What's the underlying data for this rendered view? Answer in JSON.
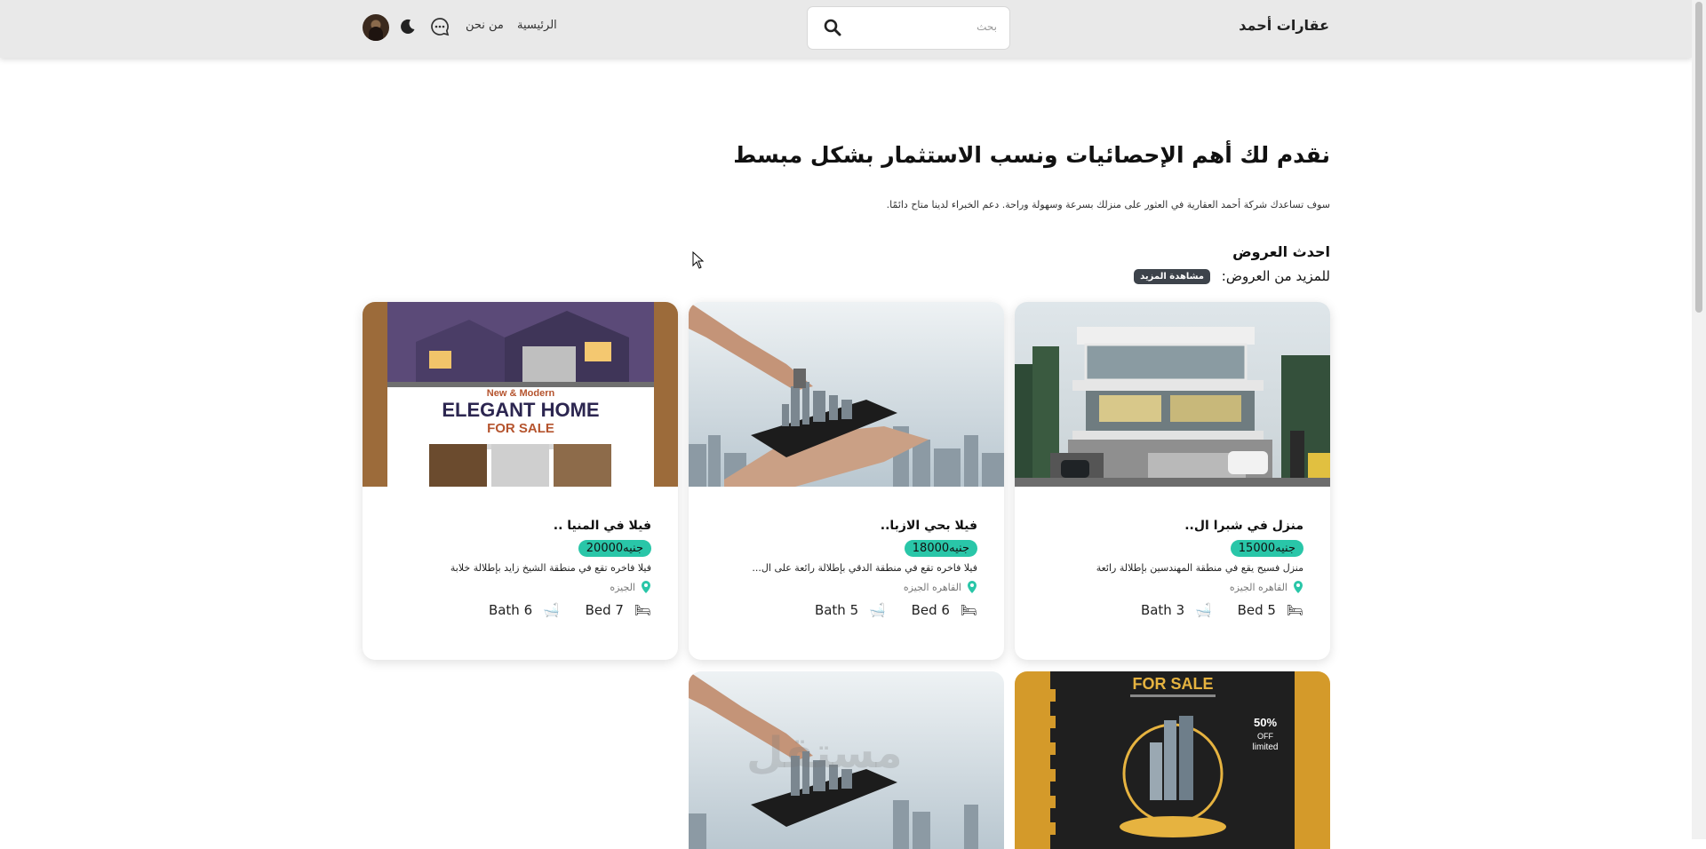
{
  "nav": {
    "brand": "عقارات أحمد",
    "search_placeholder": "بحث",
    "home": "الرئيسية",
    "about": "من نحن",
    "icons": [
      "search-icon",
      "chat-icon",
      "moon-icon",
      "avatar"
    ]
  },
  "hero": {
    "title": "نقدم لك أهم الإحصائيات ونسب الاستثمار بشكل مبسط",
    "subtitle": "سوف تساعدك شركة أحمد العقارية في العثور على منزلك بسرعة وسهولة وراحة. دعم الخبراء لدينا متاح دائمًا."
  },
  "offers": {
    "title": "احدث العروض",
    "more_text": "للمزيد من العروض:",
    "more_button": "مشاهدة المزيد"
  },
  "cards": [
    {
      "title": "منزل في شبرا ال..",
      "price": "15000جنيه",
      "desc": "منزل فسيح يقع في منطقة المهندسين بإطلالة رائعة",
      "location": "القاهره الجيزه",
      "bath": "Bath 3",
      "bed": "Bed 5",
      "image": "modern-house-photo"
    },
    {
      "title": "فيلا بحي الازبا..",
      "price": "18000جنيه",
      "desc": "فيلا فاخره تقع في منطقة الدقي بإطلالة رائعة على ال...",
      "location": "القاهره الجيزه",
      "bath": "Bath 5",
      "bed": "Bed 6",
      "image": "hand-holding-city-photo"
    },
    {
      "title": "فيلا في المنيا ..",
      "price": "20000جنيه",
      "desc": "فيلا فاخره تقع في منطقة الشيخ زايد بإطلالة خلابة",
      "location": "الجيزه",
      "bath": "Bath 6",
      "bed": "Bed 7",
      "image": "elegant-home-flyer"
    }
  ],
  "flyer": {
    "line1": "New & Modern",
    "line2": "ELEGANT HOME",
    "line3": "FOR SALE"
  },
  "sale_flyer": {
    "title": "FOR SALE",
    "badge_pct": "50%",
    "badge_off": "OFF",
    "badge_limited": "limited"
  },
  "watermark": "مستقل"
}
